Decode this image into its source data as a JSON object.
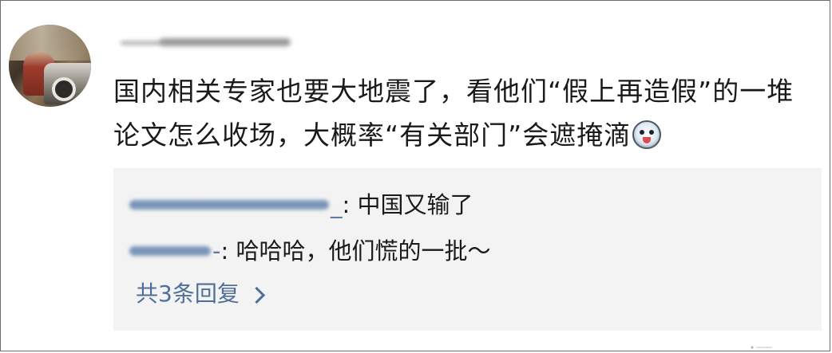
{
  "comment": {
    "text": "国内相关专家也要大地震了，看他们“假上再造假”的一堆论文怎么收场，大概率“有关部门”会遮掩滴",
    "emoji": "grinning-dog-emoji"
  },
  "replies": [
    {
      "name_tail": "_",
      "text": ": 中国又输了"
    },
    {
      "name_tail": "-",
      "text": ": 哈哈哈，他们慌的一批～"
    }
  ],
  "more": {
    "label": "共3条回复"
  },
  "colors": {
    "link": "#4f6f99",
    "reply_bg": "#f3f3f3",
    "text": "#1a1a1a"
  }
}
